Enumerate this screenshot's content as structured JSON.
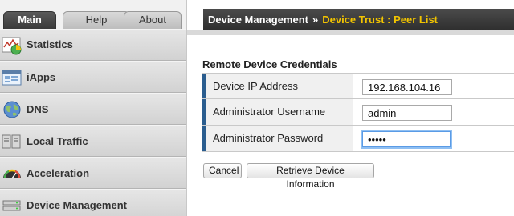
{
  "tabs": {
    "main": "Main",
    "help": "Help",
    "about": "About"
  },
  "nav": {
    "items": [
      {
        "label": "Statistics",
        "icon": "statistics-chart-icon"
      },
      {
        "label": "iApps",
        "icon": "iapps-window-icon"
      },
      {
        "label": "DNS",
        "icon": "globe-icon"
      },
      {
        "label": "Local Traffic",
        "icon": "server-icon"
      },
      {
        "label": "Acceleration",
        "icon": "gauge-icon"
      },
      {
        "label": "Device Management",
        "icon": "device-icon"
      }
    ]
  },
  "header": {
    "section": "Device Management",
    "separator": "»",
    "current": "Device Trust : Peer List"
  },
  "form": {
    "title": "Remote Device Credentials",
    "fields": [
      {
        "label": "Device IP Address",
        "value": "192.168.104.16"
      },
      {
        "label": "Administrator Username",
        "value": "admin"
      },
      {
        "label": "Administrator Password",
        "value": "•••••"
      }
    ]
  },
  "buttons": {
    "cancel": "Cancel",
    "retrieve": "Retrieve Device Information"
  },
  "colors": {
    "header_bg": "#3a3a3a",
    "breadcrumb_current": "#f2c400",
    "row_marker": "#2a5d8f"
  }
}
